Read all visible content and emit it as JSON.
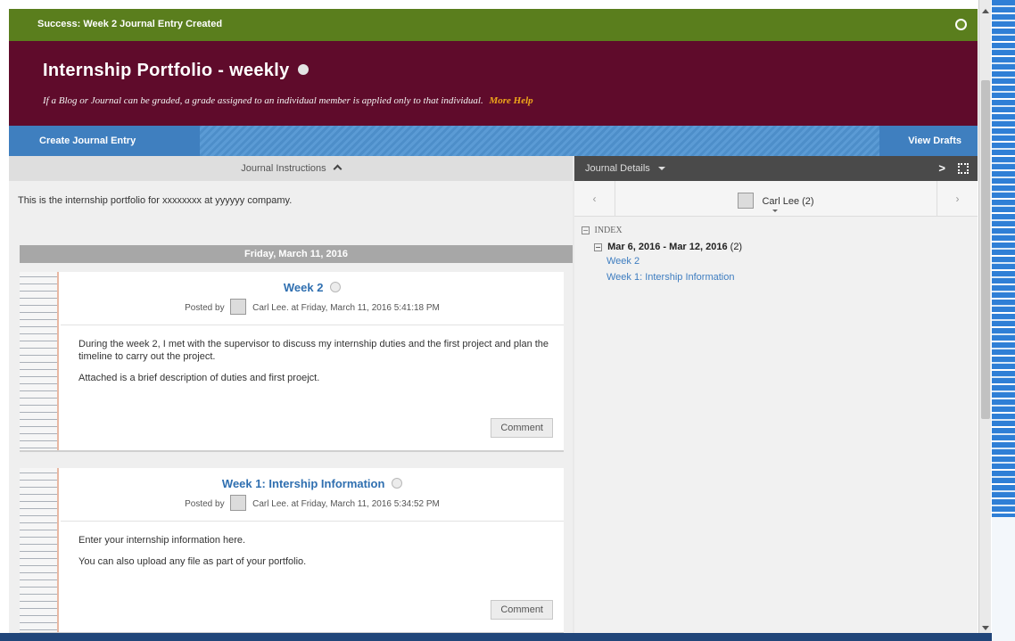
{
  "success": {
    "message": "Success: Week 2 Journal Entry Created"
  },
  "header": {
    "title": "Internship Portfolio - weekly",
    "subtitle": "If a Blog or Journal can be graded, a grade assigned to an individual member is applied only to that individual.",
    "more_help": "More Help"
  },
  "actions": {
    "create": "Create Journal Entry",
    "view_drafts": "View Drafts"
  },
  "instructions": {
    "header": "Journal Instructions",
    "text": "This is the internship portfolio for xxxxxxxx at yyyyyy compamy."
  },
  "date_header": "Friday, March 11, 2016",
  "entries": [
    {
      "title": "Week 2",
      "posted": "Posted by",
      "author": "Carl Lee.",
      "timestamp": "at Friday, March 11, 2016 5:41:18 PM",
      "paragraphs": [
        "During the week 2, I met with the supervisor to discuss my internship duties and the first project and plan the timeline to carry out the project.",
        "Attached is a brief description of duties and first proejct."
      ],
      "comment": "Comment"
    },
    {
      "title": "Week 1: Intership Information",
      "posted": "Posted by",
      "author": "Carl Lee.",
      "timestamp": "at Friday, March 11, 2016 5:34:52 PM",
      "paragraphs": [
        "Enter your internship information here.",
        "You can also upload any file as part of your portfolio."
      ],
      "comment": "Comment"
    }
  ],
  "details": {
    "header": "Journal Details",
    "user": "Carl Lee (2)",
    "index_label": "INDEX",
    "range": "Mar 6, 2016 - Mar 12, 2016",
    "range_count": "(2)",
    "links": [
      "Week 2",
      "Week 1: Intership Information"
    ]
  },
  "colors": {
    "success": "#5a7e1d",
    "header": "#5f0b2b",
    "action_bar": "#5b9bd5",
    "link": "#2f6fb0",
    "more_help": "#f0a81a"
  },
  "icons": [
    "close-icon",
    "status-dot-icon",
    "chevron-up-icon",
    "comment-count-icon",
    "avatar-icon",
    "chevron-left-icon",
    "chevron-right-icon",
    "expand-icon",
    "collapse-toggle-icon"
  ]
}
